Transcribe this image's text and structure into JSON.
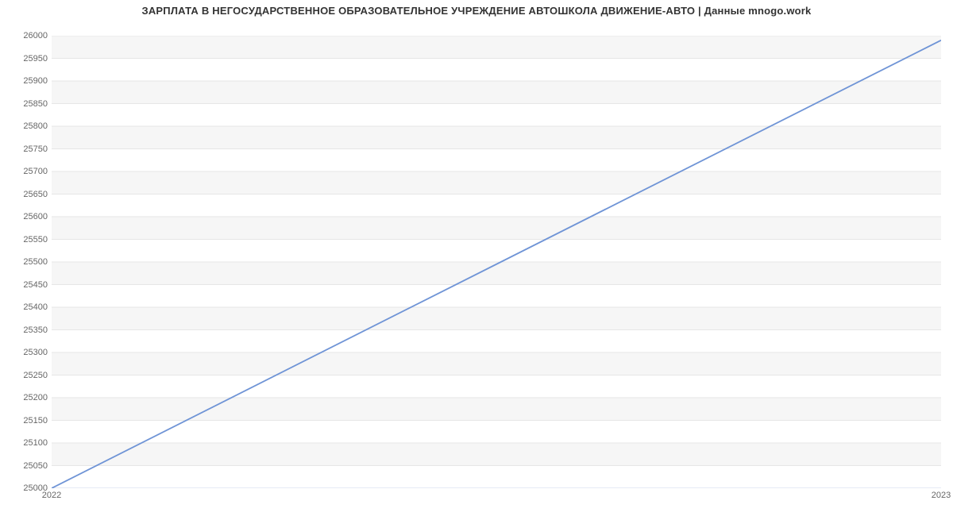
{
  "chart_data": {
    "type": "line",
    "title": "ЗАРПЛАТА В НЕГОСУДАРСТВЕННОЕ ОБРАЗОВАТЕЛЬНОЕ УЧРЕЖДЕНИЕ АВТОШКОЛА ДВИЖЕНИЕ-АВТО | Данные mnogo.work",
    "x": [
      "2022",
      "2023"
    ],
    "series": [
      {
        "name": "salary",
        "values": [
          25000,
          25990
        ],
        "color": "#6f94d6"
      }
    ],
    "y_ticks": [
      25000,
      25050,
      25100,
      25150,
      25200,
      25250,
      25300,
      25350,
      25400,
      25450,
      25500,
      25550,
      25600,
      25650,
      25700,
      25750,
      25800,
      25850,
      25900,
      25950,
      26000
    ],
    "x_ticks": [
      "2022",
      "2023"
    ],
    "ylim": [
      25000,
      26000
    ],
    "xlabel": "",
    "ylabel": "",
    "grid": true
  }
}
